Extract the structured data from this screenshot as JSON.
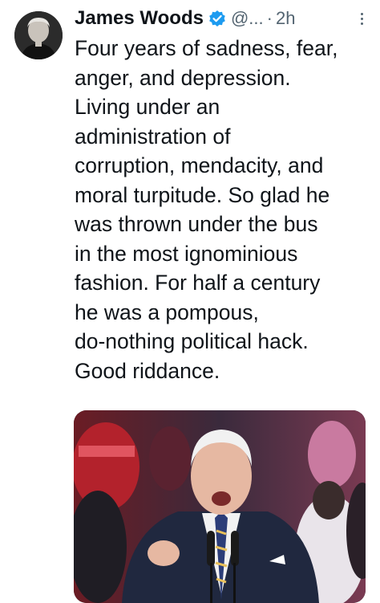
{
  "tweet": {
    "author_name": "James Woods",
    "handle": "@...",
    "separator": "·",
    "time": "2h",
    "text_lines": [
      "Four years of sadness, fear,",
      "anger, and depression.",
      "Living under an",
      "administration of",
      "corruption, mendacity, and",
      "moral turpitude. So glad he",
      "was thrown under the bus",
      "in the most ignominious",
      "fashion. For half a century",
      "he was a pompous,",
      "do-nothing political hack.",
      "Good riddance."
    ]
  },
  "icons": {
    "verified": "verified-badge-icon",
    "more": "more-options-icon"
  },
  "colors": {
    "verified_blue": "#1d9bf0",
    "text": "#0f1419",
    "secondary": "#536471"
  }
}
